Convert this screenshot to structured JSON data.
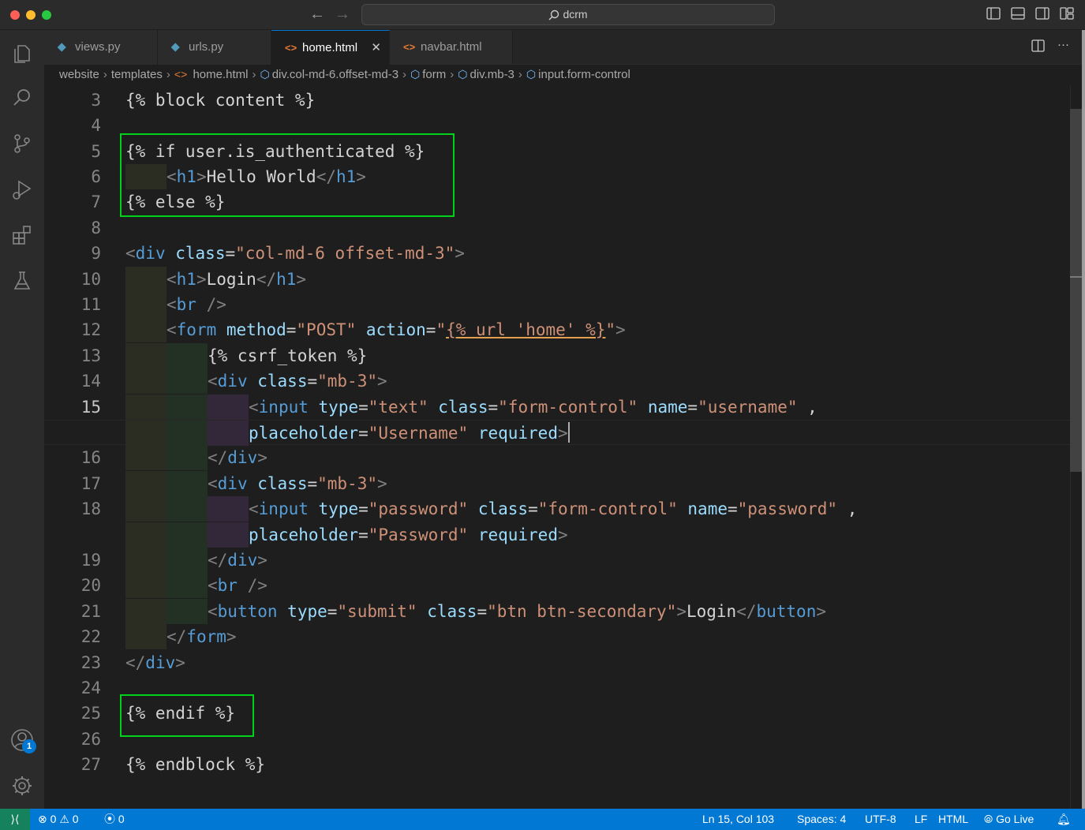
{
  "window": {
    "search_text": "dcrm"
  },
  "tabs": [
    {
      "label": "views.py",
      "icon": "python-icon",
      "active": false
    },
    {
      "label": "urls.py",
      "icon": "python-icon",
      "active": false
    },
    {
      "label": "home.html",
      "icon": "html-icon",
      "active": true
    },
    {
      "label": "navbar.html",
      "icon": "html-icon",
      "active": false
    }
  ],
  "breadcrumb": [
    "website",
    "templates",
    "home.html",
    "div.col-md-6.offset-md-3",
    "form",
    "div.mb-3",
    "input.form-control"
  ],
  "editor": {
    "current_line": "15",
    "lines": [
      {
        "n": "3",
        "text": "{% block content %}"
      },
      {
        "n": "4",
        "text": ""
      },
      {
        "n": "5",
        "text": "{% if user.is_authenticated %}"
      },
      {
        "n": "6",
        "text": "<h1>Hello World</h1>"
      },
      {
        "n": "7",
        "text": "{% else %}"
      },
      {
        "n": "8",
        "text": ""
      },
      {
        "n": "9",
        "text": "<div class=\"col-md-6 offset-md-3\">"
      },
      {
        "n": "10",
        "text": "<h1>Login</h1>"
      },
      {
        "n": "11",
        "text": "<br />"
      },
      {
        "n": "12",
        "text": "<form method=\"POST\" action=\"{% url 'home' %}\">"
      },
      {
        "n": "13",
        "text": "{% csrf_token %}"
      },
      {
        "n": "14",
        "text": "<div class=\"mb-3\">"
      },
      {
        "n": "15",
        "text": "<input type=\"text\" class=\"form-control\" name=\"username\" ,"
      },
      {
        "n": "",
        "text": "placeholder=\"Username\" required>"
      },
      {
        "n": "16",
        "text": "</div>"
      },
      {
        "n": "17",
        "text": "<div class=\"mb-3\">"
      },
      {
        "n": "18",
        "text": "<input type=\"password\" class=\"form-control\" name=\"password\" ,"
      },
      {
        "n": "",
        "text": "placeholder=\"Password\" required>"
      },
      {
        "n": "19",
        "text": "</div>"
      },
      {
        "n": "20",
        "text": "<br />"
      },
      {
        "n": "21",
        "text": "<button type=\"submit\" class=\"btn btn-secondary\">Login</button>"
      },
      {
        "n": "22",
        "text": "</form>"
      },
      {
        "n": "23",
        "text": "</div>"
      },
      {
        "n": "24",
        "text": ""
      },
      {
        "n": "25",
        "text": "{% endif %}"
      },
      {
        "n": "26",
        "text": ""
      },
      {
        "n": "27",
        "text": "{% endblock %}"
      }
    ]
  },
  "activity_bar": {
    "icons": [
      "explorer-icon",
      "search-icon",
      "source-control-icon",
      "run-debug-icon",
      "extensions-icon",
      "testing-icon"
    ],
    "bottom_icons": [
      "accounts-icon",
      "settings-icon"
    ],
    "accounts_badge": "1"
  },
  "status_bar": {
    "errors": "0",
    "warnings": "0",
    "ports": "0",
    "position": "Ln 15, Col 103",
    "spaces": "Spaces: 4",
    "encoding": "UTF-8",
    "eol": "LF",
    "language": "HTML",
    "go_live": "Go Live"
  },
  "colors": {
    "accent": "#0078d4",
    "highlight_box": "#00d11a",
    "tag": "#569cd6",
    "attribute": "#9cdcfe",
    "string": "#ce9178"
  }
}
